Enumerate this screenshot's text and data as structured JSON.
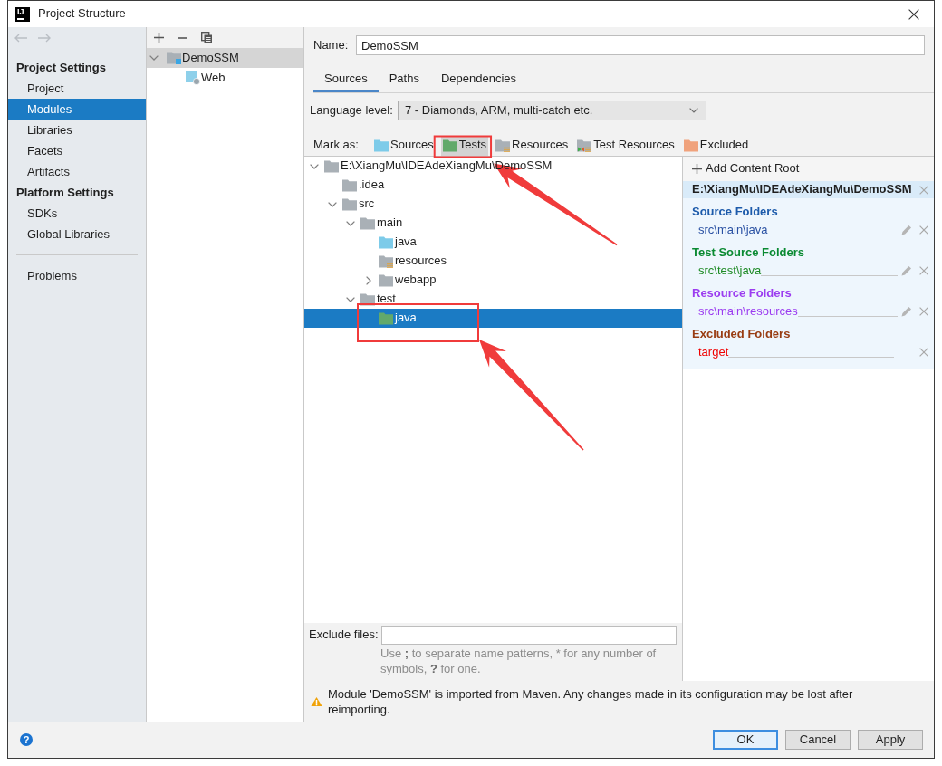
{
  "window": {
    "app_icon": "IJ",
    "title": "Project Structure"
  },
  "sidebar": {
    "back": {
      "disabled": true
    },
    "forward": {
      "disabled": true
    },
    "groups": [
      {
        "heading": "Project Settings",
        "items": [
          {
            "label": "Project",
            "selected": false
          },
          {
            "label": "Modules",
            "selected": true
          },
          {
            "label": "Libraries",
            "selected": false
          },
          {
            "label": "Facets",
            "selected": false
          },
          {
            "label": "Artifacts",
            "selected": false
          }
        ]
      },
      {
        "heading": "Platform Settings",
        "items": [
          {
            "label": "SDKs",
            "selected": false
          },
          {
            "label": "Global Libraries",
            "selected": false
          }
        ]
      }
    ],
    "footer_items": [
      {
        "label": "Problems",
        "selected": false
      }
    ]
  },
  "module_list": {
    "items": [
      {
        "label": "DemoSSM",
        "kind": "module",
        "expanded": true,
        "selected": true,
        "children": [
          {
            "label": "Web",
            "kind": "web",
            "selected": false
          }
        ]
      }
    ]
  },
  "module": {
    "name_label": "Name:",
    "name": "DemoSSM",
    "tabs": [
      {
        "label": "Sources",
        "selected": true
      },
      {
        "label": "Paths",
        "selected": false
      },
      {
        "label": "Dependencies",
        "selected": false
      }
    ],
    "language_level": {
      "label": "Language level:",
      "value": "7 - Diamonds, ARM, multi-catch etc."
    },
    "mark_as": {
      "label": "Mark as:",
      "options": [
        {
          "label": "Sources",
          "kind": "source",
          "selected": false
        },
        {
          "label": "Tests",
          "kind": "test",
          "selected": true
        },
        {
          "label": "Resources",
          "kind": "resource",
          "selected": false
        },
        {
          "label": "Test Resources",
          "kind": "test_resource",
          "selected": false
        },
        {
          "label": "Excluded",
          "kind": "excluded",
          "selected": false
        }
      ]
    },
    "tree": [
      {
        "label": "E:\\XiangMu\\IDEAdeXiangMu\\DemoSSM",
        "kind": "folder",
        "expanded": true,
        "selected": false,
        "children": [
          {
            "label": ".idea",
            "kind": "folder",
            "selected": false
          },
          {
            "label": "src",
            "kind": "folder",
            "expanded": true,
            "selected": false,
            "children": [
              {
                "label": "main",
                "kind": "folder",
                "expanded": true,
                "selected": false,
                "children": [
                  {
                    "label": "java",
                    "kind": "source",
                    "selected": false
                  },
                  {
                    "label": "resources",
                    "kind": "resource",
                    "selected": false
                  },
                  {
                    "label": "webapp",
                    "kind": "folder",
                    "expanded": false,
                    "selected": false
                  }
                ]
              },
              {
                "label": "test",
                "kind": "folder",
                "expanded": true,
                "selected": false,
                "children": [
                  {
                    "label": "java",
                    "kind": "test",
                    "selected": true
                  }
                ]
              }
            ]
          }
        ]
      }
    ],
    "exclude_files": {
      "label": "Exclude files:",
      "hint": "Use **;** to separate name patterns, * for any number of symbols, **?** for one."
    },
    "content_root": {
      "add_label": "Add Content Root",
      "path": "E:\\XiangMu\\IDEAdeXiangMu\\DemoSSM",
      "sections": [
        {
          "title": "Source Folders",
          "color": "#1d5bab",
          "folders": [
            {
              "path": "src\\main\\java",
              "color": "#2a51a3",
              "editable": true
            }
          ]
        },
        {
          "title": "Test Source Folders",
          "color": "#0a8a32",
          "folders": [
            {
              "path": "src\\test\\java",
              "color": "#1d8a24",
              "editable": true
            }
          ]
        },
        {
          "title": "Resource Folders",
          "color": "#9b3cf0",
          "folders": [
            {
              "path": "src\\main\\resources",
              "color": "#9b3cf0",
              "editable": true
            }
          ]
        },
        {
          "title": "Excluded Folders",
          "color": "#983c12",
          "folders": [
            {
              "path": "target",
              "color": "#f00000",
              "editable": false
            }
          ]
        }
      ]
    },
    "warning": "Module 'DemoSSM' is imported from Maven. Any changes made in its configuration may be lost after reimporting."
  },
  "help_button": "?",
  "buttons": [
    {
      "label": "OK",
      "default": true
    },
    {
      "label": "Cancel",
      "default": false
    },
    {
      "label": "Apply",
      "default": false
    }
  ]
}
